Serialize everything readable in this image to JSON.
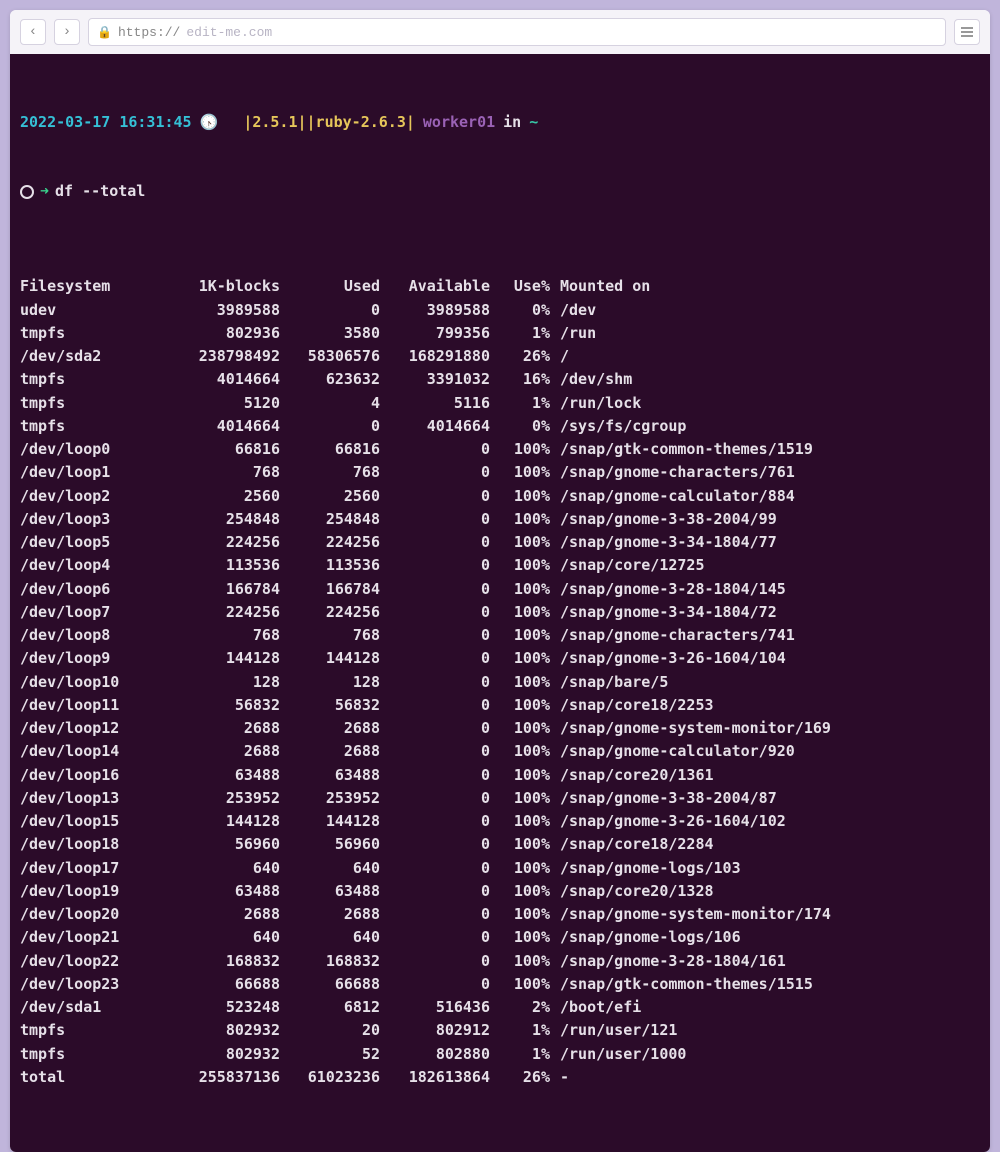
{
  "browser": {
    "url_proto": "https://",
    "url_host": "edit-me.com"
  },
  "prompt": {
    "timestamp": "2022-03-17 16:31:45",
    "versions": "|2.5.1||ruby-2.6.3|",
    "hostname": "worker01",
    "in_word": "in",
    "cwd": "~",
    "command": "df --total"
  },
  "df": {
    "headers": [
      "Filesystem",
      "1K-blocks",
      "Used",
      "Available",
      "Use%",
      "Mounted on"
    ],
    "rows": [
      [
        "udev",
        "3989588",
        "0",
        "3989588",
        "0%",
        "/dev"
      ],
      [
        "tmpfs",
        "802936",
        "3580",
        "799356",
        "1%",
        "/run"
      ],
      [
        "/dev/sda2",
        "238798492",
        "58306576",
        "168291880",
        "26%",
        "/"
      ],
      [
        "tmpfs",
        "4014664",
        "623632",
        "3391032",
        "16%",
        "/dev/shm"
      ],
      [
        "tmpfs",
        "5120",
        "4",
        "5116",
        "1%",
        "/run/lock"
      ],
      [
        "tmpfs",
        "4014664",
        "0",
        "4014664",
        "0%",
        "/sys/fs/cgroup"
      ],
      [
        "/dev/loop0",
        "66816",
        "66816",
        "0",
        "100%",
        "/snap/gtk-common-themes/1519"
      ],
      [
        "/dev/loop1",
        "768",
        "768",
        "0",
        "100%",
        "/snap/gnome-characters/761"
      ],
      [
        "/dev/loop2",
        "2560",
        "2560",
        "0",
        "100%",
        "/snap/gnome-calculator/884"
      ],
      [
        "/dev/loop3",
        "254848",
        "254848",
        "0",
        "100%",
        "/snap/gnome-3-38-2004/99"
      ],
      [
        "/dev/loop5",
        "224256",
        "224256",
        "0",
        "100%",
        "/snap/gnome-3-34-1804/77"
      ],
      [
        "/dev/loop4",
        "113536",
        "113536",
        "0",
        "100%",
        "/snap/core/12725"
      ],
      [
        "/dev/loop6",
        "166784",
        "166784",
        "0",
        "100%",
        "/snap/gnome-3-28-1804/145"
      ],
      [
        "/dev/loop7",
        "224256",
        "224256",
        "0",
        "100%",
        "/snap/gnome-3-34-1804/72"
      ],
      [
        "/dev/loop8",
        "768",
        "768",
        "0",
        "100%",
        "/snap/gnome-characters/741"
      ],
      [
        "/dev/loop9",
        "144128",
        "144128",
        "0",
        "100%",
        "/snap/gnome-3-26-1604/104"
      ],
      [
        "/dev/loop10",
        "128",
        "128",
        "0",
        "100%",
        "/snap/bare/5"
      ],
      [
        "/dev/loop11",
        "56832",
        "56832",
        "0",
        "100%",
        "/snap/core18/2253"
      ],
      [
        "/dev/loop12",
        "2688",
        "2688",
        "0",
        "100%",
        "/snap/gnome-system-monitor/169"
      ],
      [
        "/dev/loop14",
        "2688",
        "2688",
        "0",
        "100%",
        "/snap/gnome-calculator/920"
      ],
      [
        "/dev/loop16",
        "63488",
        "63488",
        "0",
        "100%",
        "/snap/core20/1361"
      ],
      [
        "/dev/loop13",
        "253952",
        "253952",
        "0",
        "100%",
        "/snap/gnome-3-38-2004/87"
      ],
      [
        "/dev/loop15",
        "144128",
        "144128",
        "0",
        "100%",
        "/snap/gnome-3-26-1604/102"
      ],
      [
        "/dev/loop18",
        "56960",
        "56960",
        "0",
        "100%",
        "/snap/core18/2284"
      ],
      [
        "/dev/loop17",
        "640",
        "640",
        "0",
        "100%",
        "/snap/gnome-logs/103"
      ],
      [
        "/dev/loop19",
        "63488",
        "63488",
        "0",
        "100%",
        "/snap/core20/1328"
      ],
      [
        "/dev/loop20",
        "2688",
        "2688",
        "0",
        "100%",
        "/snap/gnome-system-monitor/174"
      ],
      [
        "/dev/loop21",
        "640",
        "640",
        "0",
        "100%",
        "/snap/gnome-logs/106"
      ],
      [
        "/dev/loop22",
        "168832",
        "168832",
        "0",
        "100%",
        "/snap/gnome-3-28-1804/161"
      ],
      [
        "/dev/loop23",
        "66688",
        "66688",
        "0",
        "100%",
        "/snap/gtk-common-themes/1515"
      ],
      [
        "/dev/sda1",
        "523248",
        "6812",
        "516436",
        "2%",
        "/boot/efi"
      ],
      [
        "tmpfs",
        "802932",
        "20",
        "802912",
        "1%",
        "/run/user/121"
      ],
      [
        "tmpfs",
        "802932",
        "52",
        "802880",
        "1%",
        "/run/user/1000"
      ],
      [
        "total",
        "255837136",
        "61023236",
        "182613864",
        "26%",
        "-"
      ]
    ]
  }
}
